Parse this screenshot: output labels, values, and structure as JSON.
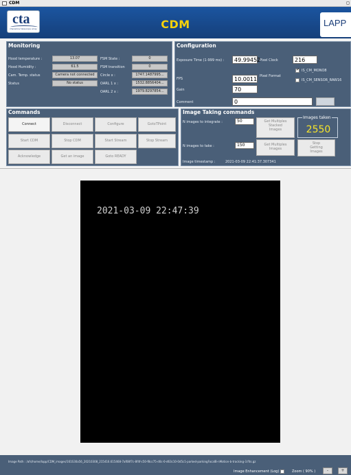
{
  "window": {
    "title": "CDM",
    "control_icon": "maximize-icon"
  },
  "header": {
    "logo_text": "cta",
    "logo_subtext": "cherenkov telescope array",
    "app_title": "CDM",
    "partner_logo_text": "LAPP"
  },
  "monitoring": {
    "title": "Monitoring",
    "hood_temperature": {
      "label": "Hood temperature :",
      "value": "13.07"
    },
    "hood_humidity": {
      "label": "Hood Humidity :",
      "value": "61.5"
    },
    "cam_temp_status": {
      "label": "Cam. Temp. status",
      "value": "Camera not connected"
    },
    "status": {
      "label": "Status",
      "value": "No status"
    },
    "fsm_state": {
      "label": "FSM State :",
      "value": "0"
    },
    "fsm_transition": {
      "label": "FSM transition",
      "value": "0"
    },
    "circle_x": {
      "label": "Circle x :",
      "value": "1747.1487995..."
    },
    "oarl_1x": {
      "label": "OARL 1 x :",
      "value": "1532.8856404..."
    },
    "oarl_2x": {
      "label": "OARL 2 x :",
      "value": "1979.8297854..."
    }
  },
  "configuration": {
    "title": "Configuration",
    "exposure": {
      "label": "Exposure Time (1-999 ms) :",
      "value": "49.99452"
    },
    "pixel_clock": {
      "label": "Pixel Clock",
      "value": "216"
    },
    "pixel_format": {
      "label": "Pixel Format"
    },
    "fps": {
      "label": "FPS",
      "value": "10.0011"
    },
    "gain": {
      "label": "Gain",
      "value": "70"
    },
    "comment": {
      "label": "Comment",
      "value": "0"
    },
    "format_mono8": {
      "label": "IS_CM_MONO8",
      "checked": true
    },
    "format_raw16": {
      "label": "IS_CM_SENSOR_RAW16",
      "checked": false
    }
  },
  "commands": {
    "title": "Commands",
    "connect": "Connect",
    "disconnect": "Disconnect",
    "configure": "Configure",
    "goto_tpoint": "GotoTPoint",
    "start_cdm": "Start CDM",
    "stop_cdm": "Stop CDM",
    "start_stream": "Start Stream",
    "stop_stream": "Stop Stream",
    "acknowledge": "Acknowledge",
    "get_image": "Get an image",
    "goto_ready": "Goto READY"
  },
  "image_taking": {
    "title": "Image Taking commands",
    "n_integrate": {
      "label": "N images to integrate :",
      "value": "50"
    },
    "n_take": {
      "label": "N images to take :",
      "value": "150"
    },
    "get_multiple_stacked": [
      "Get Multiples",
      "Stacked",
      "Images"
    ],
    "get_multiple_images": [
      "Get Multiples",
      "Images"
    ],
    "stop_getting": [
      "Stop",
      "Getting",
      "Images"
    ],
    "images_taken_label": "Images taken",
    "images_taken_value": "2550",
    "timestamp_label": "Image timestamp :",
    "timestamp_value": "2021-03-09 22:41:37.307341"
  },
  "image": {
    "timestamp_overlay": "2021-03-09 22:47:39"
  },
  "footer": {
    "image_path_label": "Image Path :",
    "image_path_value": "/afs/home/lapp/CDM_images/161S30a56_20210308_215416.615468-7af08f7c-8f4f-c50-f8cc75-d0c-0-d63c10-0d5c1-parked-parkingFocalB-nMotion-b-tracking-3.fits.gz",
    "enhancement_label": "Image Enhancement (Log)",
    "zoom_label": "Zoom ( 90% )",
    "zoom_out": "-",
    "zoom_in": "+"
  }
}
